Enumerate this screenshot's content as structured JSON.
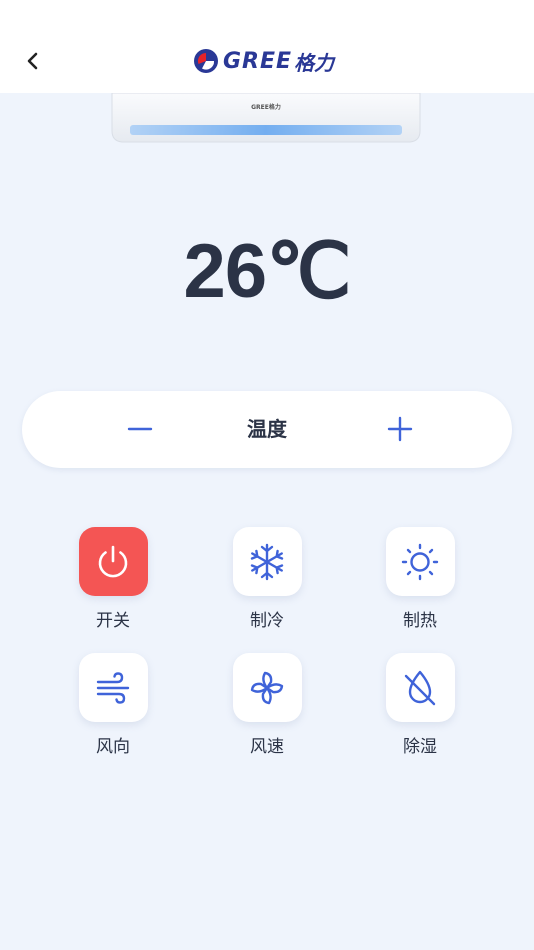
{
  "header": {
    "brand": "GREE",
    "brand_cn": "格力"
  },
  "temperature": {
    "value": "26℃"
  },
  "temp_control": {
    "label": "温度",
    "minus": "−",
    "plus": "+"
  },
  "functions": [
    {
      "label": "开关",
      "icon": "power-icon",
      "active": true,
      "color": "#f45554"
    },
    {
      "label": "制冷",
      "icon": "snowflake-icon"
    },
    {
      "label": "制热",
      "icon": "sun-icon"
    },
    {
      "label": "风向",
      "icon": "wind-direction-icon"
    },
    {
      "label": "风速",
      "icon": "fan-icon"
    },
    {
      "label": "除湿",
      "icon": "dehumidify-icon"
    }
  ],
  "colors": {
    "accent": "#3f63d9",
    "power": "#f45554",
    "background": "#eff4fc",
    "text": "#2b3346"
  }
}
